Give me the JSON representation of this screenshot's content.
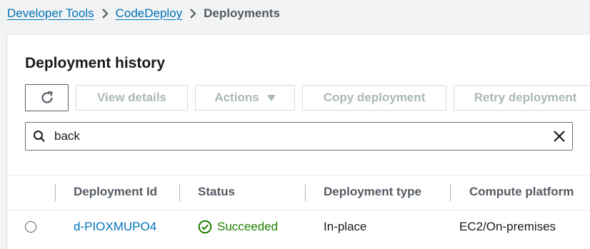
{
  "breadcrumb": {
    "items": [
      "Developer Tools",
      "CodeDeploy"
    ],
    "current": "Deployments"
  },
  "panel": {
    "title": "Deployment history"
  },
  "toolbar": {
    "refresh_icon": "refresh-icon",
    "view_details": "View details",
    "actions": "Actions",
    "copy_deployment": "Copy deployment",
    "retry_deployment": "Retry deployment"
  },
  "search": {
    "value": "back",
    "icon": "search-icon",
    "clear_icon": "close-icon"
  },
  "table": {
    "columns": [
      "Deployment Id",
      "Status",
      "Deployment type",
      "Compute platform"
    ],
    "rows": [
      {
        "id": "d-PIOXMUPO4",
        "status": "Succeeded",
        "type": "In-place",
        "platform": "EC2/On-premises"
      }
    ]
  },
  "colors": {
    "link": "#0073bb",
    "success": "#1d8102",
    "disabled": "#aab7b8",
    "heading": "#16191f"
  }
}
